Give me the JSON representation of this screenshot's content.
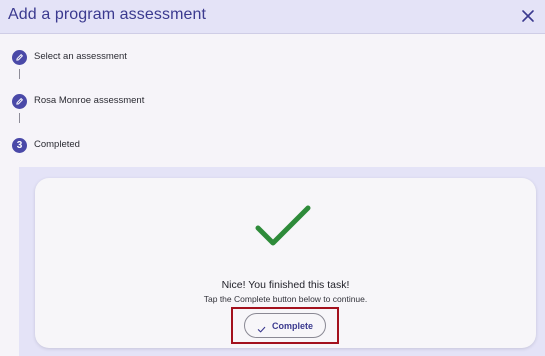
{
  "dialog": {
    "title": "Add a program assessment"
  },
  "steps": [
    {
      "label": "Select an assessment",
      "state": "completed",
      "icon": "pencil-icon"
    },
    {
      "label": "Rosa Monroe assessment",
      "state": "completed",
      "icon": "pencil-icon"
    },
    {
      "label": "Completed",
      "state": "current",
      "number": "3"
    }
  ],
  "success": {
    "title": "Nice! You finished this task!",
    "subtitle": "Tap the Complete button below to continue.",
    "icon": "checkmark-icon"
  },
  "actions": {
    "complete_label": "Complete",
    "complete_icon": "check-icon"
  },
  "colors": {
    "accent": "#4a49a8",
    "success": "#2e8b3a",
    "highlight_border": "#a3111d",
    "header_bg": "#e4e3f7"
  }
}
